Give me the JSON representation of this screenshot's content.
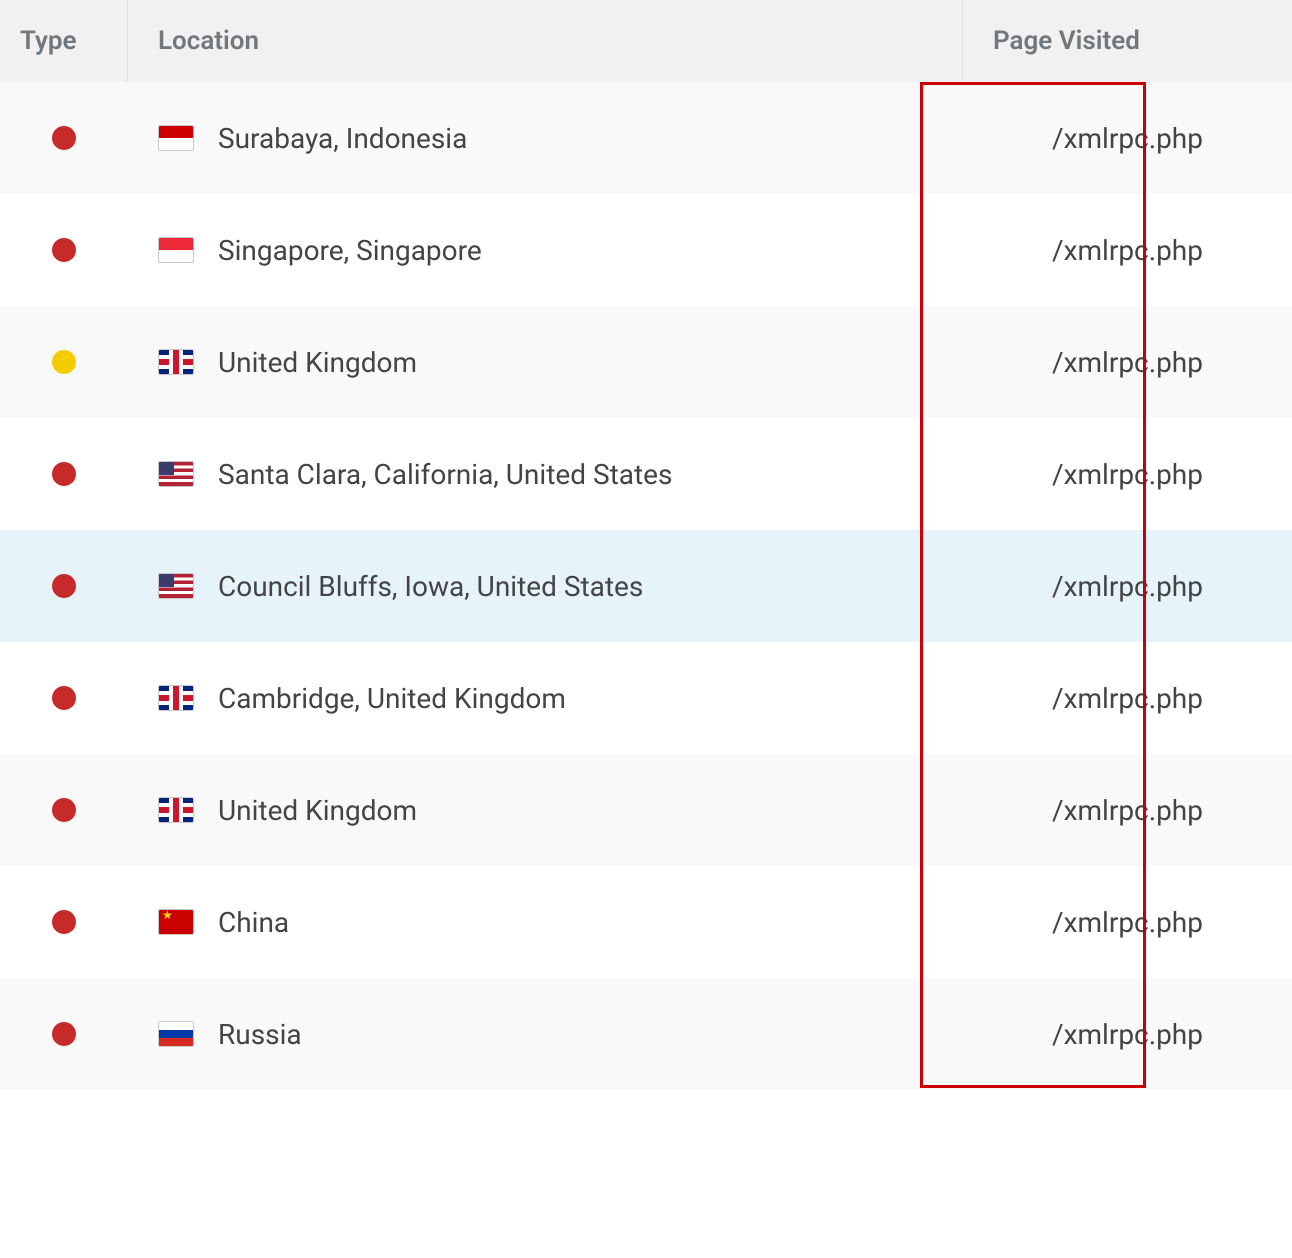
{
  "table": {
    "headers": {
      "type": "Type",
      "location": "Location",
      "page_visited": "Page Visited"
    },
    "rows": [
      {
        "status": "red",
        "flag": "flag-id",
        "location": "Surabaya, Indonesia",
        "page": "/xmlrpc.php",
        "highlighted": false
      },
      {
        "status": "red",
        "flag": "flag-sg",
        "location": "Singapore, Singapore",
        "page": "/xmlrpc.php",
        "highlighted": false
      },
      {
        "status": "yellow",
        "flag": "flag-uk",
        "location": "United Kingdom",
        "page": "/xmlrpc.php",
        "highlighted": false
      },
      {
        "status": "red",
        "flag": "flag-us",
        "location": "Santa Clara, California, United States",
        "page": "/xmlrpc.php",
        "highlighted": false
      },
      {
        "status": "red",
        "flag": "flag-us",
        "location": "Council Bluffs, Iowa, United States",
        "page": "/xmlrpc.php",
        "highlighted": true
      },
      {
        "status": "red",
        "flag": "flag-uk",
        "location": "Cambridge, United Kingdom",
        "page": "/xmlrpc.php",
        "highlighted": false
      },
      {
        "status": "red",
        "flag": "flag-uk",
        "location": "United Kingdom",
        "page": "/xmlrpc.php",
        "highlighted": false
      },
      {
        "status": "red",
        "flag": "flag-cn",
        "location": "China",
        "page": "/xmlrpc.php",
        "highlighted": false
      },
      {
        "status": "red",
        "flag": "flag-ru",
        "location": "Russia",
        "page": "/xmlrpc.php",
        "highlighted": false
      }
    ]
  },
  "colors": {
    "status_red": "#c72a2a",
    "status_yellow": "#f3cd00",
    "highlight_border": "#cc0000",
    "row_highlight_bg": "#e6f3fb"
  }
}
